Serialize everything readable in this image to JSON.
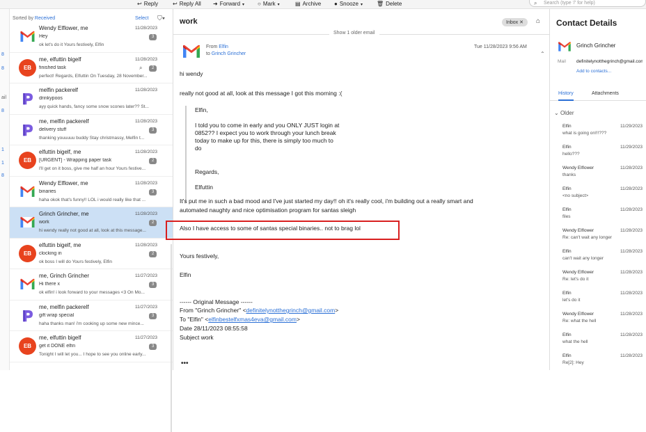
{
  "toolbar": {
    "reply": "Reply",
    "reply_all": "Reply All",
    "forward": "Forward",
    "mark": "Mark",
    "archive": "Archive",
    "snooze": "Snooze",
    "delete": "Delete",
    "search_placeholder": "Search (type '/' for help)"
  },
  "left_counts": [
    "8",
    "8",
    "8",
    "1",
    "1",
    "8"
  ],
  "left_label": "ail",
  "list": {
    "sorted_by": "Sorted by",
    "sorted_field": "Received",
    "select": "Select",
    "rows": [
      {
        "avatar": "gmail",
        "name": "Wendy Elflower, me",
        "date": "11/28/2023",
        "subject": "Hey",
        "count": "3",
        "preview": "ok let's do it Yours festively, Elfin"
      },
      {
        "avatar": "eb",
        "initials": "EB",
        "name": "me, elfuttin bigelf",
        "date": "11/28/2023",
        "subject": "finished task",
        "count": "2",
        "preview": "perfect! Regards, Elfuttin On Tuesday, 28 November..."
      },
      {
        "avatar": "proton",
        "name": "melfin packerelf",
        "date": "11/28/2023",
        "subject": "drinkypoos",
        "count": "",
        "preview": "ayy quick hands, fancy some snow scones later?? St..."
      },
      {
        "avatar": "proton",
        "name": "me, melfin packerelf",
        "date": "11/28/2023",
        "subject": "delivery stuff",
        "count": "3",
        "preview": "thanking youuuuu buddy Stay christmassy, Melfin t..."
      },
      {
        "avatar": "eb",
        "initials": "EB",
        "name": "elfuttin bigelf, me",
        "date": "11/28/2023",
        "subject": "[URGENT] - Wrapping paper task",
        "count": "2",
        "preview": "I'll get on it boss, give me half an hour Yours festive..."
      },
      {
        "avatar": "gmail",
        "name": "Wendy Elflower, me",
        "date": "11/28/2023",
        "subject": "binaries",
        "count": "3",
        "preview": "haha okok that's funny!! LOL i would really like that ..."
      },
      {
        "avatar": "gmail",
        "name": "Grinch Grincher, me",
        "date": "11/28/2023",
        "subject": "work",
        "count": "2",
        "preview": "hi wendy really not good at all, look at this message..."
      },
      {
        "avatar": "eb",
        "initials": "EB",
        "name": "elfuttin bigelf, me",
        "date": "11/28/2023",
        "subject": "clocking in",
        "count": "2",
        "preview": "ok boss I will do Yours festively, Elfin"
      },
      {
        "avatar": "gmail",
        "name": "me, Grinch Grincher",
        "date": "11/27/2023",
        "subject": "Hi there x",
        "count": "3",
        "preview": "ok elfin! i look forward to your messages <3 On Mo..."
      },
      {
        "avatar": "proton",
        "name": "me, melfin packerelf",
        "date": "11/27/2023",
        "subject": "gift wrap special",
        "count": "3",
        "preview": "haha thanks man! i'm cooking up some new mince..."
      },
      {
        "avatar": "eb",
        "initials": "EB",
        "name": "me, elfuttin bigelf",
        "date": "11/27/2023",
        "subject": "get it DONE elfin",
        "count": "3",
        "preview": "Tonight I will let you... I hope to see you online early..."
      }
    ]
  },
  "message": {
    "subject": "work",
    "tag": "Inbox",
    "show_older": "Show 1 older email",
    "from_label": "From",
    "from": "Elfin",
    "to_label": "to",
    "to": "Grinch Grincher",
    "date": "Tue 11/28/2023 9:56 AM",
    "greeting": "hi wendy",
    "line1": "really not good at all, look at this message I got this morning :(",
    "quote": {
      "salute": "Elfin,",
      "l1": "I told you to come in early and you ONLY JUST login at",
      "l2": "0852?? I expect you to work through your lunch break",
      "l3": "today to make up for this, there is simply too much to",
      "l4": "do",
      "regards": "Regards,",
      "sign": "Elfuttin"
    },
    "line2": "It's put me in such a bad mood and I've just started my day!! oh it's really cool, i'm building out a really smart and",
    "line3": "automated naughty and nice optimisation program for santas sleigh",
    "highlight": "Also I have access to some of santas special binaries.. not to brag lol",
    "closing": "Yours festively,",
    "signature": "Elfin",
    "orig_header": "------ Original Message ------",
    "orig_from": "From \"Grinch Grincher\" <",
    "orig_from_email": "definitelynotthegrinch@gmail.com",
    "orig_from_end": ">",
    "orig_to": "To \"Elfin\" <",
    "orig_to_email": "elfinbestelfxmas4eva@gmail.com",
    "orig_to_end": ">",
    "orig_date": "Date 28/11/2023 08:55:58",
    "orig_subject": "Subject work",
    "more": "•••"
  },
  "contact": {
    "title": "Contact Details",
    "name": "Grinch Grincher",
    "mail_label": "Mail",
    "mail": "definitelynotthegrinch@gmail.com",
    "add": "Add to contacts...",
    "tab_history": "History",
    "tab_attachments": "Attachments",
    "older": "Older",
    "history": [
      {
        "name": "Elfin",
        "date": "11/29/2023",
        "subject": "what is going on!!!???"
      },
      {
        "name": "Elfin",
        "date": "11/29/2023",
        "subject": "hello???"
      },
      {
        "name": "Wendy Elflower",
        "date": "11/28/2023",
        "subject": "thanks"
      },
      {
        "name": "Elfin",
        "date": "11/28/2023",
        "subject": "<no subject>"
      },
      {
        "name": "Elfin",
        "date": "11/28/2023",
        "subject": "files"
      },
      {
        "name": "Wendy Elflower",
        "date": "11/28/2023",
        "subject": "Re: can't wait any longer"
      },
      {
        "name": "Elfin",
        "date": "11/28/2023",
        "subject": "can't wait any longer"
      },
      {
        "name": "Wendy Elflower",
        "date": "11/28/2023",
        "subject": "Re: let's do it"
      },
      {
        "name": "Elfin",
        "date": "11/28/2023",
        "subject": "let's do it"
      },
      {
        "name": "Wendy Elflower",
        "date": "11/28/2023",
        "subject": "Re: what the hell"
      },
      {
        "name": "Elfin",
        "date": "11/28/2023",
        "subject": "what the hell"
      },
      {
        "name": "Elfin",
        "date": "11/28/2023",
        "subject": "Re[2]: Hey"
      }
    ]
  }
}
